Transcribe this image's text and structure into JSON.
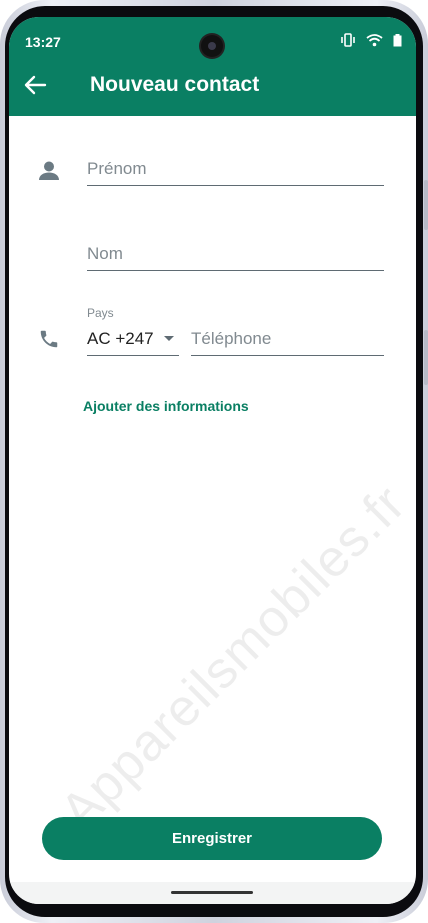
{
  "status_bar": {
    "time": "13:27"
  },
  "app_bar": {
    "title": "Nouveau contact"
  },
  "form": {
    "first_name": {
      "placeholder": "Prénom",
      "value": ""
    },
    "last_name": {
      "placeholder": "Nom",
      "value": ""
    },
    "country": {
      "label": "Pays",
      "value": "AC +247"
    },
    "phone": {
      "placeholder": "Téléphone",
      "value": ""
    },
    "more_info_link": "Ajouter des informations"
  },
  "actions": {
    "save_label": "Enregistrer"
  },
  "watermark": "Appareilsmobiles.fr",
  "colors": {
    "accent": "#0a7f63",
    "icon": "#6b7a83",
    "background": "#ffffff"
  },
  "icons": [
    "back-arrow-icon",
    "person-icon",
    "phone-icon",
    "vibrate-icon",
    "wifi-icon",
    "battery-icon"
  ]
}
